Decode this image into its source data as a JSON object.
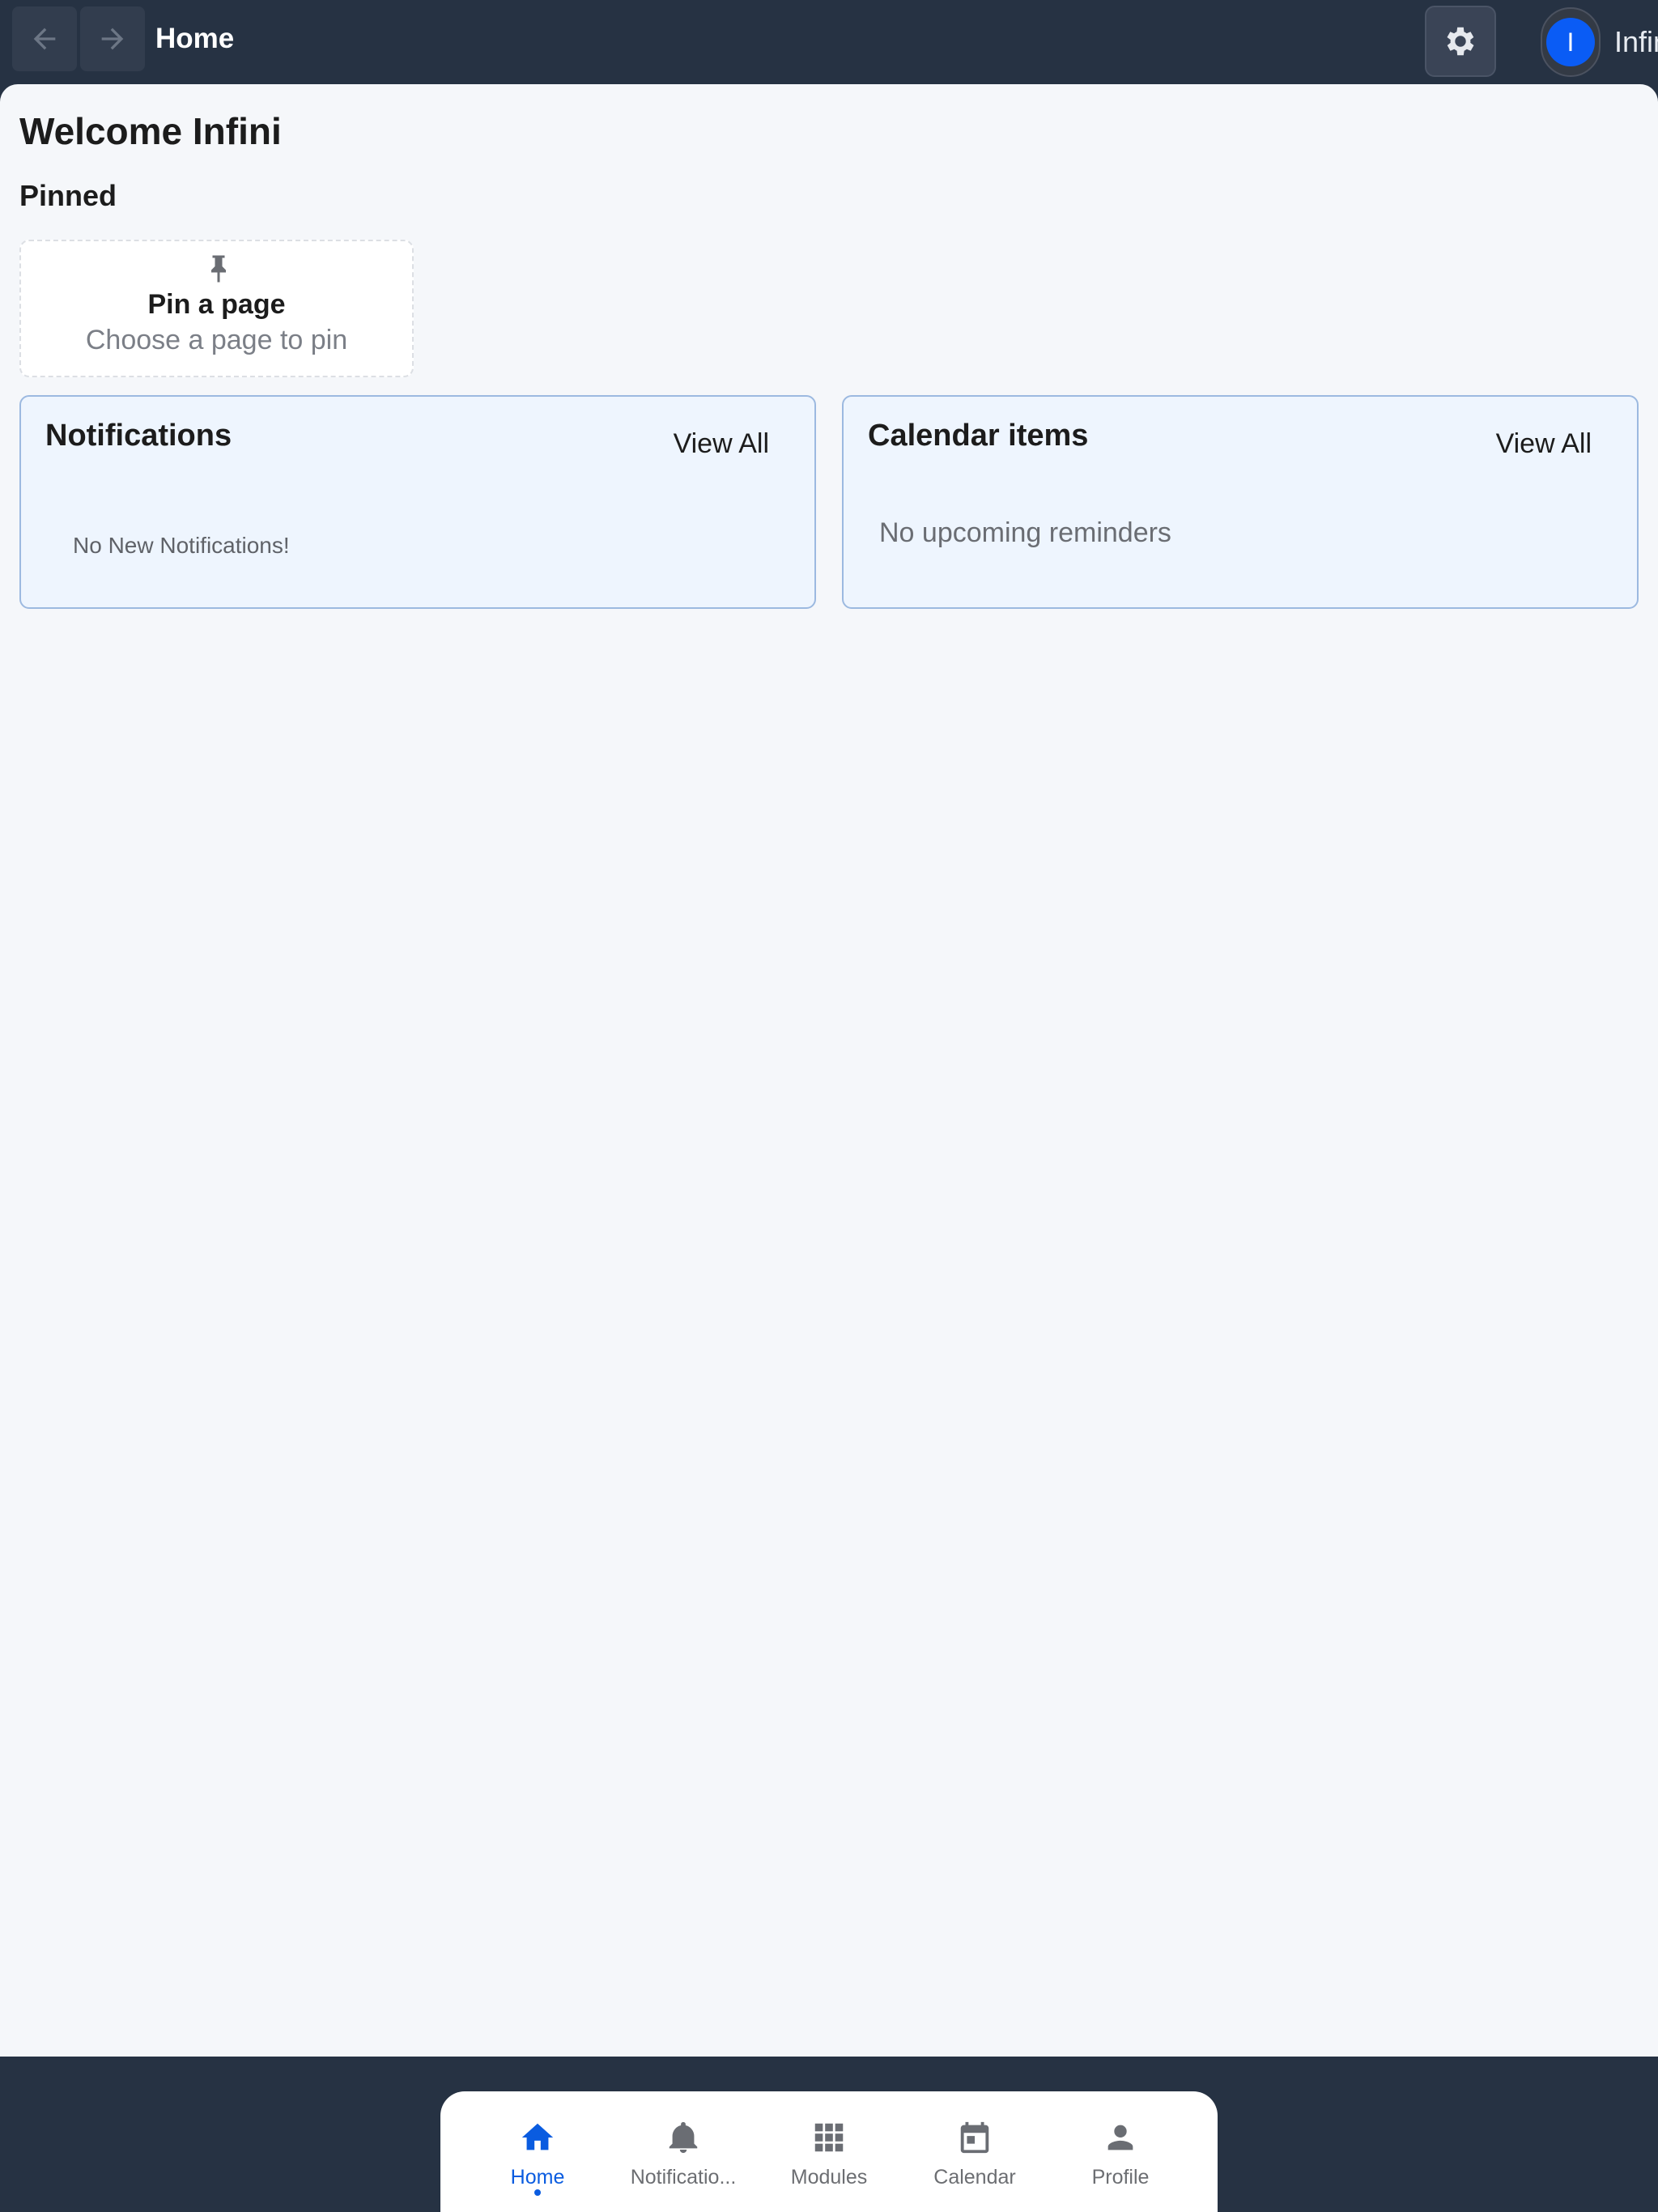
{
  "topbar": {
    "title": "Home",
    "user_initial": "I",
    "user_name": "Infini"
  },
  "main": {
    "welcome": "Welcome Infini",
    "pinned_heading": "Pinned",
    "pin_card": {
      "title": "Pin a page",
      "subtitle": "Choose a page to pin"
    },
    "notifications_panel": {
      "title": "Notifications",
      "view_all": "View All",
      "empty_text": "No New Notifications!"
    },
    "calendar_panel": {
      "title": "Calendar items",
      "view_all": "View All",
      "empty_text": "No upcoming reminders"
    }
  },
  "bottom_nav": {
    "items": [
      {
        "label": "Home",
        "icon": "home-icon",
        "active": true
      },
      {
        "label": "Notificatio...",
        "icon": "bell-icon",
        "active": false
      },
      {
        "label": "Modules",
        "icon": "grid-icon",
        "active": false
      },
      {
        "label": "Calendar",
        "icon": "calendar-icon",
        "active": false
      },
      {
        "label": "Profile",
        "icon": "person-icon",
        "active": false
      }
    ]
  },
  "colors": {
    "chrome_background": "#263243",
    "content_background": "#f5f7fa",
    "accent_blue": "#0a5ce0",
    "avatar_blue": "#0a5cf5",
    "panel_background": "#eef5fe",
    "panel_border": "#9cb9e0"
  }
}
